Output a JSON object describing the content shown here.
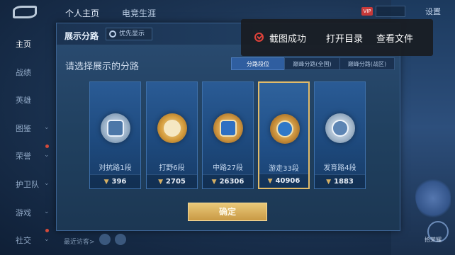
{
  "topbar": {
    "tabs": [
      "个人主页",
      "电竞生涯"
    ],
    "settings_label": "设置",
    "badge": "VIP"
  },
  "leftnav": {
    "items": [
      "主页",
      "战绩",
      "英雄",
      "图鉴",
      "荣誉",
      "护卫队",
      "游戏",
      "社交"
    ]
  },
  "panel": {
    "title": "展示分路",
    "priority_label": "优先显示",
    "subtitle": "请选择展示的分路",
    "tabs": [
      "分路段位",
      "巅峰分路(全国)",
      "巅峰分路(战区)"
    ],
    "cards": [
      {
        "label": "对抗路1段",
        "score": "396"
      },
      {
        "label": "打野6段",
        "score": "2705"
      },
      {
        "label": "中路27段",
        "score": "26306"
      },
      {
        "label": "游走33段",
        "score": "40906"
      },
      {
        "label": "发育路4段",
        "score": "1883"
      }
    ],
    "confirm_label": "确定"
  },
  "toast": {
    "message": "截图成功",
    "open_dir": "打开目录",
    "view_file": "查看文件"
  },
  "bottom": {
    "chat_hint": "最近访客>",
    "right_button_label": "拾荣耀"
  },
  "colors": {
    "accent_gold": "#e1bb6a",
    "tab_active": "#2f5ea0",
    "toast_red": "#e0423a"
  }
}
